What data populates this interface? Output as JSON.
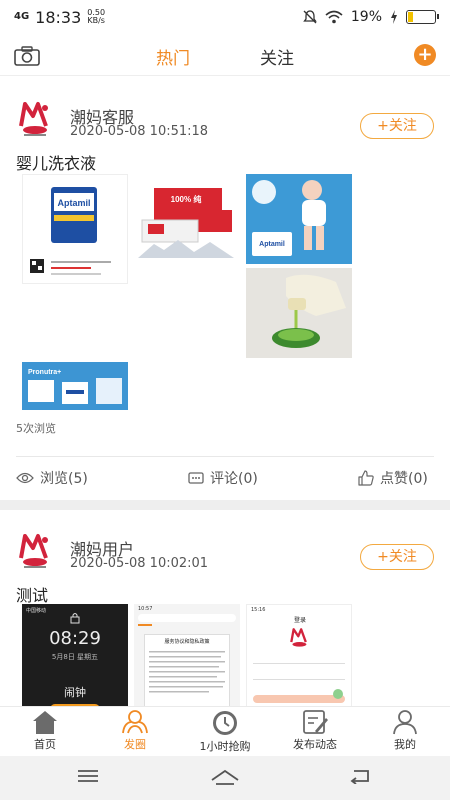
{
  "status_bar": {
    "network": "4G",
    "time": "18:33",
    "speed_value": "0.50",
    "speed_unit": "KB/s",
    "battery": "19%",
    "battery_level": 0.19,
    "icons": [
      "mute-icon",
      "wifi-icon",
      "charging-icon",
      "battery-icon"
    ]
  },
  "top_nav": {
    "camera_icon": "camera-icon",
    "tabs": [
      {
        "label": "热门",
        "active": true
      },
      {
        "label": "关注",
        "active": false
      }
    ],
    "add_label": "+"
  },
  "posts": [
    {
      "user_name": "潮妈客服",
      "timestamp": "2020-05-08 10:51:18",
      "follow_label": "+关注",
      "title": "婴儿洗衣液",
      "images": [
        "aptamil-formula-card",
        "baby-wipes-package",
        "baby-aptamil-ad",
        "detergent-pour-photo",
        "pronutra-formula-banner"
      ],
      "views": "5次浏览",
      "actions": {
        "browse": "浏览(5)",
        "comment": "评论(0)",
        "like": "点赞(0)"
      }
    },
    {
      "user_name": "潮妈用户",
      "timestamp": "2020-05-08 10:02:01",
      "follow_label": "+关注",
      "title": "测试",
      "images": [
        "lockscreen-screenshot",
        "privacy-dialog-screenshot",
        "login-screenshot"
      ],
      "image_texts": {
        "lock_time": "08:29",
        "lock_date": "5月8日 星期五",
        "lock_alarm": "闹钟",
        "privacy_heading": "服务协议和隐私政策",
        "login_heading": "登录",
        "status_left": "中国移动",
        "status_time_2": "10:57",
        "status_time_3": "15:16"
      }
    }
  ],
  "tab_bar": [
    {
      "label": "首页",
      "icon": "home-icon",
      "active": false
    },
    {
      "label": "发圈",
      "icon": "circle-icon",
      "active": true
    },
    {
      "label": "1小时抢购",
      "icon": "clock-icon",
      "active": false
    },
    {
      "label": "发布动态",
      "icon": "edit-icon",
      "active": false
    },
    {
      "label": "我的",
      "icon": "user-icon",
      "active": false
    }
  ],
  "colors": {
    "accent": "#f08a24",
    "follow_border": "#f3a940"
  }
}
